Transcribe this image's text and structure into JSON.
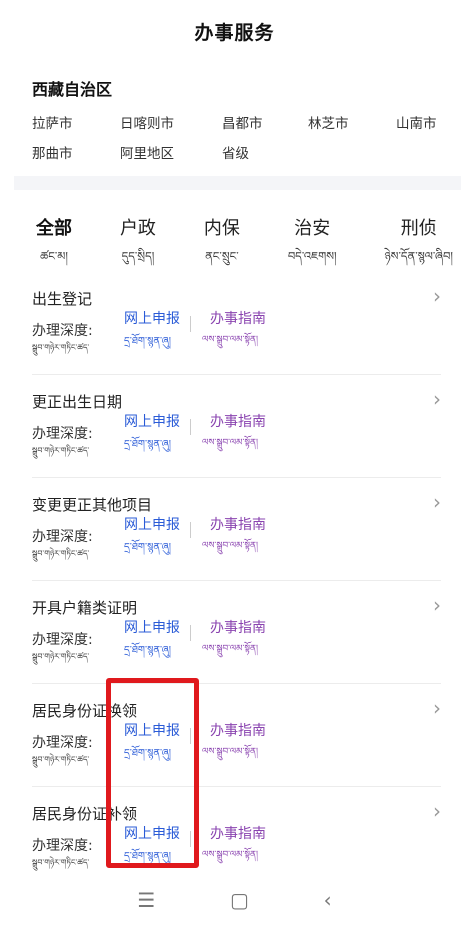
{
  "header": {
    "title": "办事服务"
  },
  "region": {
    "title": "西藏自治区",
    "cities": [
      "拉萨市",
      "日喀则市",
      "昌都市",
      "林芝市",
      "山南市",
      "那曲市",
      "阿里地区",
      "省级"
    ]
  },
  "tabs": [
    {
      "zh": "全部",
      "bo": "ཚང་མ།"
    },
    {
      "zh": "户政",
      "bo": "དུད་སྲིད།"
    },
    {
      "zh": "内保",
      "bo": "ནང་སྲུང་"
    },
    {
      "zh": "治安",
      "bo": "བདེ་འཇགས།"
    },
    {
      "zh": "刑侦",
      "bo": "ཉེས་དོན་སྙལ་ཞིབ།"
    }
  ],
  "services": [
    {
      "name": "出生登记"
    },
    {
      "name": "更正出生日期"
    },
    {
      "name": "变更更正其他项目"
    },
    {
      "name": "开具户籍类证明"
    },
    {
      "name": "居民身份证换领"
    },
    {
      "name": "居民身份证补领"
    }
  ],
  "labels": {
    "depth": "办理深度:",
    "depth_bo": "སྒྲུབ་གཉེར་གཏིང་ཚད་",
    "online": "网上申报",
    "online_bo": "དྲ་ཐོག་སྙན་ཞུ།",
    "guide": "办事指南",
    "guide_bo": "ལས་སྒྲུབ་ལམ་སྟོན།",
    "chevron": "›"
  },
  "navbar": {
    "menu": "☰",
    "home": "▢",
    "back": "‹"
  }
}
